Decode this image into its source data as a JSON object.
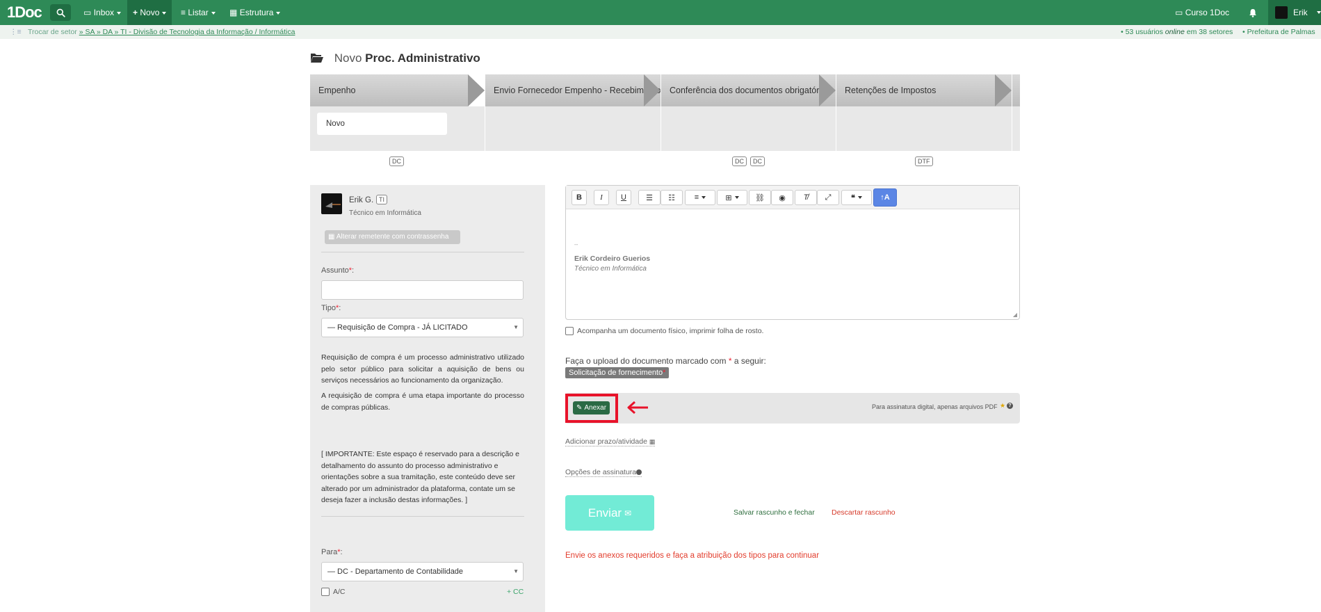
{
  "app": {
    "logo": "1Doc"
  },
  "nav": {
    "inbox": "Inbox",
    "novo": "Novo",
    "listar": "Listar",
    "estrutura": "Estrutura",
    "course": "Curso 1Doc",
    "user": "Erik"
  },
  "subbar": {
    "change_sector": "Trocar de setor",
    "breadcrumb": "» SA » DA » TI - Divisão de Tecnologia da Informação / Informática",
    "online_prefix": "• 53 usuários ",
    "online_em": "online",
    "online_suffix": " em 38 setores",
    "org": "• Prefeitura de Palmas"
  },
  "page": {
    "title_prefix": "Novo",
    "title_main": "Proc. Administrativo"
  },
  "workflow": {
    "steps": [
      "Empenho",
      "Envio Fornecedor Empenho - Recebimento",
      "Conferência dos documentos obrigatórios",
      "Retenções de Impostos"
    ],
    "current_card": "Novo",
    "tags": [
      "DC",
      "DC",
      "DC",
      "DTF"
    ]
  },
  "sender": {
    "name": "Erik G.",
    "badge": "TI",
    "role": "Técnico em Informática",
    "change_button": "Alterar remetente com contrassenha"
  },
  "form": {
    "assunto_label": "Assunto",
    "assunto_value": "",
    "tipo_label": "Tipo",
    "tipo_value": "— Requisição de Compra - JÁ LICITADO",
    "desc1": "Requisição de compra é um processo administrativo utilizado pelo setor público para solicitar a aquisição de bens ou serviços necessários ao funcionamento da organização.",
    "desc2": "A requisição de compra é uma etapa importante do processo de compras públicas.",
    "important": "[ IMPORTANTE: Este espaço é reservado para a descrição e detalhamento do assunto do processo administrativo e orientações sobre a sua tramitação, este conteúdo deve ser alterado por um administrador da plataforma, contate um se deseja fazer a inclusão destas informações. ]",
    "para_label": "Para",
    "para_value": "— DC - Departamento de Contabilidade",
    "ac_label": "A/C",
    "cc_label": "+ CC"
  },
  "editor": {
    "dash": "--",
    "signature_name": "Erik Cordeiro Guerios",
    "signature_role": "Técnico em Informática"
  },
  "physical": {
    "label": "Acompanha um documento físico, imprimir folha de rosto."
  },
  "upload": {
    "instruction_pre": "Faça o upload do documento marcado com ",
    "instruction_star": "*",
    "instruction_post": " a seguir:",
    "doc_chip": "Solicitação de fornecimento",
    "attach_button": "Anexar",
    "pdf_note": "Para assinatura digital, apenas arquivos PDF"
  },
  "links": {
    "deadline": "Adicionar prazo/atividade",
    "signature_options": "Opções de assinatura"
  },
  "actions": {
    "send": "Enviar",
    "save_draft": "Salvar rascunho e fechar",
    "discard_draft": "Descartar rascunho"
  },
  "error": "Envie os anexos requeridos e faça a atribuição dos tipos para continuar",
  "colors": {
    "brand": "#2e8a57",
    "brand_dark": "#1f6e43",
    "send": "#72ebd6",
    "error": "#e23c2c",
    "highlight": "#e8132a"
  }
}
